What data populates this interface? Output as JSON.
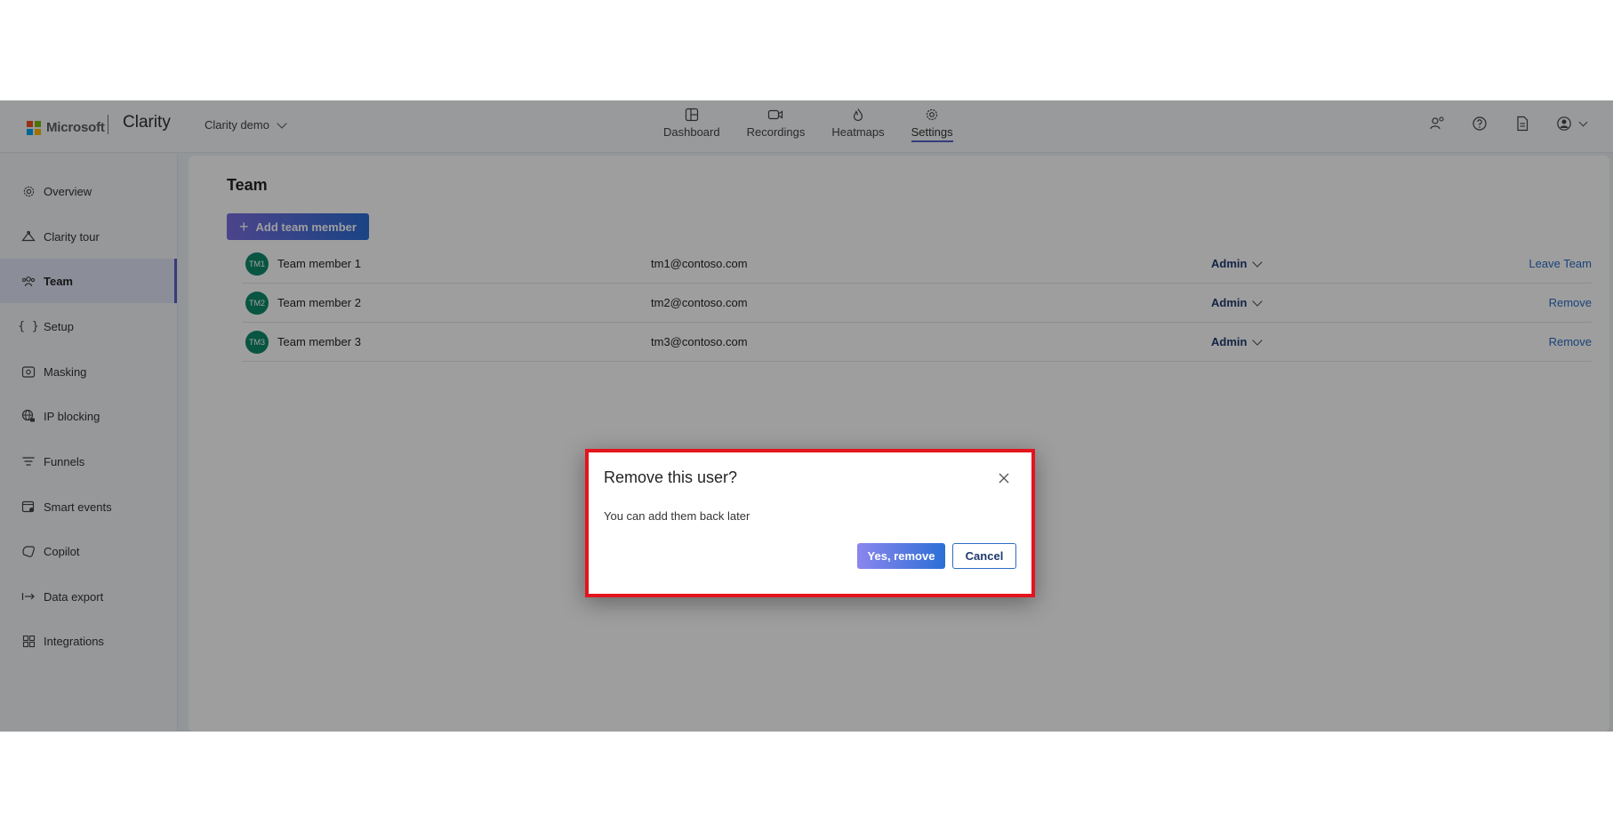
{
  "header": {
    "brand": "Microsoft",
    "product": "Clarity",
    "project": "Clarity demo",
    "brand_colors": [
      "#f25022",
      "#7fba00",
      "#00a4ef",
      "#ffb900"
    ],
    "tabs": [
      {
        "label": "Dashboard",
        "icon": "dashboard-icon",
        "active": false
      },
      {
        "label": "Recordings",
        "icon": "video-icon",
        "active": false
      },
      {
        "label": "Heatmaps",
        "icon": "flame-icon",
        "active": false
      },
      {
        "label": "Settings",
        "icon": "gear-icon",
        "active": true
      }
    ],
    "right_icons": [
      "share-user-icon",
      "help-icon",
      "document-icon",
      "account-icon"
    ]
  },
  "sidebar": {
    "items": [
      {
        "label": "Overview",
        "icon": "gear-icon"
      },
      {
        "label": "Clarity tour",
        "icon": "hanger-icon"
      },
      {
        "label": "Team",
        "icon": "team-icon",
        "active": true
      },
      {
        "label": "Setup",
        "icon": "braces-icon"
      },
      {
        "label": "Masking",
        "icon": "mask-icon"
      },
      {
        "label": "IP blocking",
        "icon": "globe-lock-icon"
      },
      {
        "label": "Funnels",
        "icon": "funnel-icon"
      },
      {
        "label": "Smart events",
        "icon": "calendar-event-icon"
      },
      {
        "label": "Copilot",
        "icon": "copilot-icon"
      },
      {
        "label": "Data export",
        "icon": "export-icon"
      },
      {
        "label": "Integrations",
        "icon": "grid-icon"
      }
    ]
  },
  "main": {
    "title": "Team",
    "add_button": "Add team member",
    "members": [
      {
        "initials": "TM1",
        "name": "Team member 1",
        "email": "tm1@contoso.com",
        "role": "Admin",
        "action": "Leave Team"
      },
      {
        "initials": "TM2",
        "name": "Team member 2",
        "email": "tm2@contoso.com",
        "role": "Admin",
        "action": "Remove"
      },
      {
        "initials": "TM3",
        "name": "Team member 3",
        "email": "tm3@contoso.com",
        "role": "Admin",
        "action": "Remove"
      }
    ]
  },
  "dialog": {
    "title": "Remove this user?",
    "body": "You can add them back later",
    "confirm": "Yes, remove",
    "cancel": "Cancel"
  }
}
